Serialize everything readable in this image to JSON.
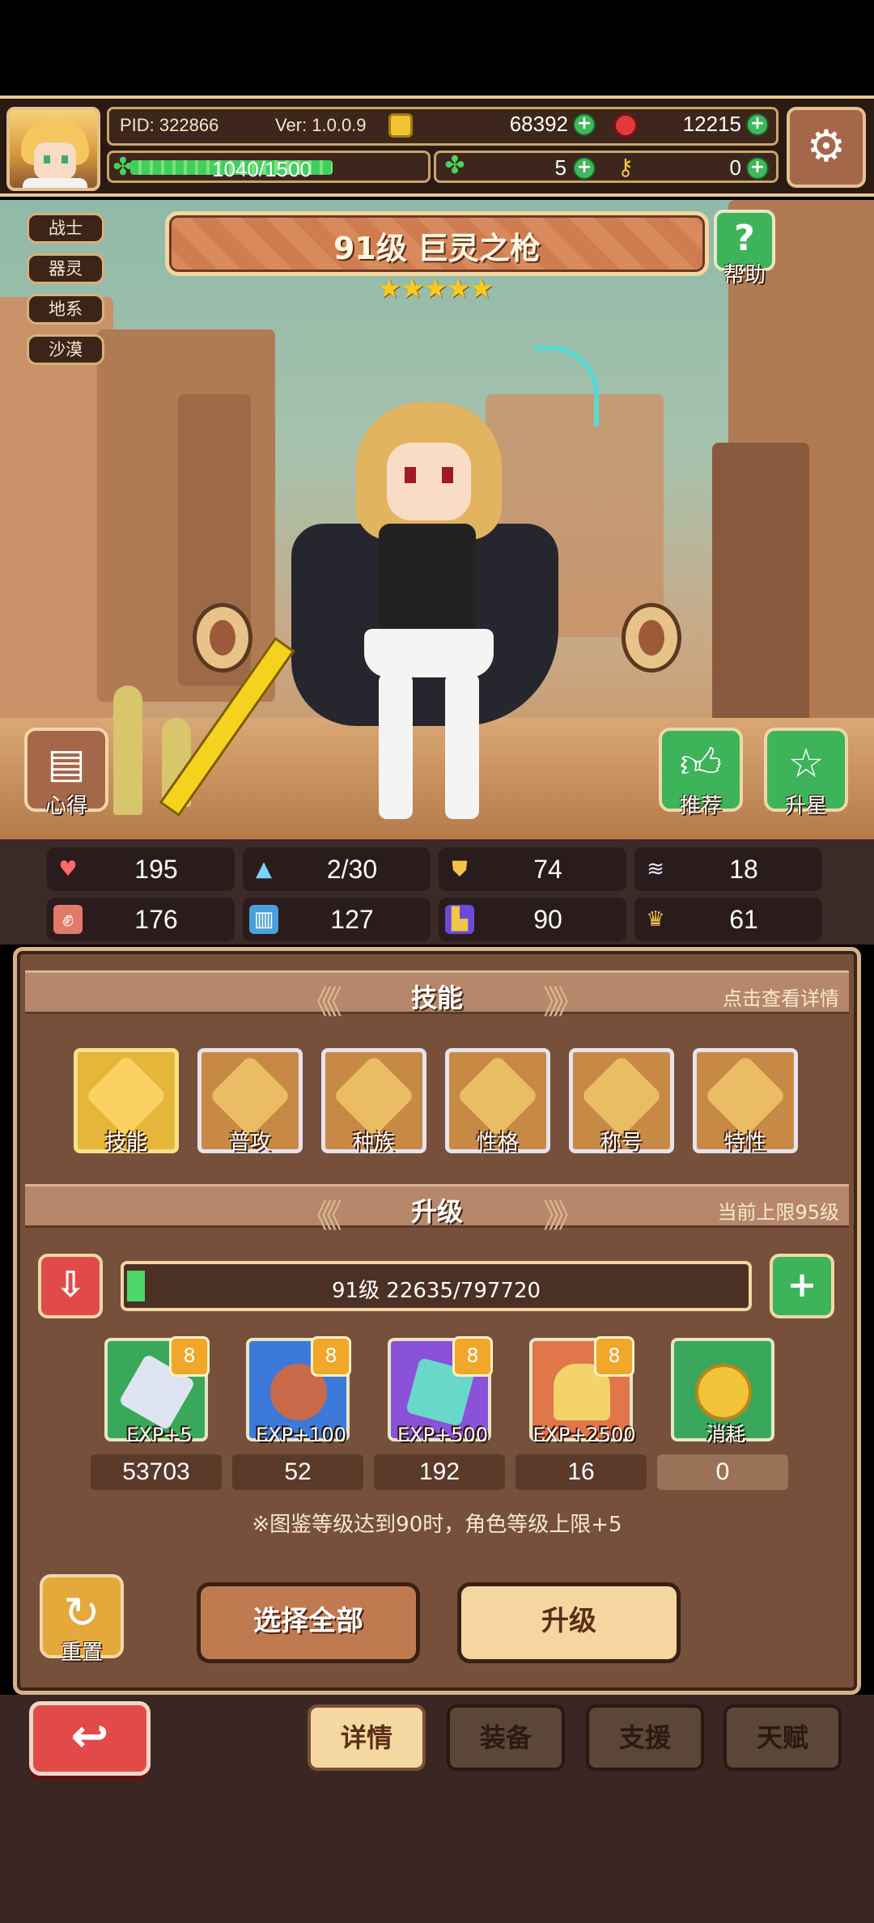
{
  "header": {
    "pid_label": "PID: 322866",
    "version_label": "Ver: 1.0.0.9",
    "gold": "68392",
    "gems": "12215",
    "exp_text": "1040/1500",
    "exp_fraction": 0.6933,
    "clover": "5",
    "keys": "0"
  },
  "scene": {
    "tags": [
      "战士",
      "器灵",
      "地系",
      "沙漠"
    ],
    "title": "91级  巨灵之枪",
    "stars": 5,
    "star_glyphs": "★★★★★",
    "help_label": "帮助",
    "tips_label": "心得",
    "recommend_label": "推荐",
    "star_up_label": "升星"
  },
  "stats": [
    {
      "icon": "heart-icon",
      "value": "195"
    },
    {
      "icon": "water-drop-icon",
      "value": "2/30"
    },
    {
      "icon": "shield-icon",
      "value": "74"
    },
    {
      "icon": "wing-icon",
      "value": "18"
    },
    {
      "icon": "fist-icon",
      "value": "176"
    },
    {
      "icon": "book-icon",
      "value": "127"
    },
    {
      "icon": "boot-icon",
      "value": "90"
    },
    {
      "icon": "crown-icon",
      "value": "61"
    }
  ],
  "skills_section": {
    "title": "技能",
    "hint": "点击查看详情",
    "items": [
      "技能",
      "普攻",
      "种族",
      "性格",
      "称号",
      "特性"
    ]
  },
  "upgrade_section": {
    "title": "升级",
    "hint": "当前上限95级",
    "level_text": "91级  22635/797720",
    "level_fraction": 0.0284,
    "items": [
      {
        "label": "EXP+5",
        "count": "53703",
        "badge": "8"
      },
      {
        "label": "EXP+100",
        "count": "52",
        "badge": "8"
      },
      {
        "label": "EXP+500",
        "count": "192",
        "badge": "8"
      },
      {
        "label": "EXP+2500",
        "count": "16",
        "badge": "8"
      },
      {
        "label": "消耗",
        "count": "0",
        "badge": ""
      }
    ],
    "note": "※图鉴等级达到90时，角色等级上限+5"
  },
  "actions": {
    "reset_label": "重置",
    "select_all_label": "选择全部",
    "upgrade_label": "升级"
  },
  "tabs": [
    "详情",
    "装备",
    "支援",
    "天赋"
  ],
  "colors": {
    "accent_green": "#3fb85c",
    "accent_red": "#e24a4a",
    "panel_brown": "#76503b",
    "active_tab": "#f4d7a1"
  }
}
